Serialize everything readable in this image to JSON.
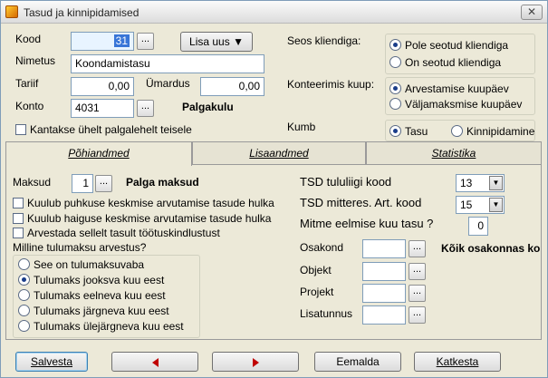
{
  "window": {
    "title": "Tasud ja kinnipidamised",
    "close_label": "✕"
  },
  "form": {
    "kood_label": "Kood",
    "kood_value": "31",
    "lisa_uus_label": "Lisa uus",
    "nimetus_label": "Nimetus",
    "nimetus_value": "Koondamistasu",
    "tariif_label": "Tariif",
    "tariif_value": "0,00",
    "umardus_label": "Ümardus",
    "umardus_value": "0,00",
    "konto_label": "Konto",
    "konto_value": "4031",
    "konto_name": "Palgakulu",
    "kantakse_label": "Kantakse ühelt palgalehelt teisele",
    "dots": "..."
  },
  "seos": {
    "label": "Seos kliendiga:",
    "options": [
      "Pole seotud kliendiga",
      "On seotud kliendiga"
    ],
    "selected": 0
  },
  "konteerimis": {
    "label": "Konteerimis kuup:",
    "options": [
      "Arvestamise kuupäev",
      "Väljamaksmise kuupäev"
    ],
    "selected": 0
  },
  "kumb": {
    "label": "Kumb",
    "options": [
      "Tasu",
      "Kinnipidamine"
    ],
    "selected": 0
  },
  "tabs": [
    "Põhiandmed",
    "Lisaandmed",
    "Statistika"
  ],
  "pohiandmed": {
    "maksud_label": "Maksud",
    "maksud_value": "1",
    "maksud_name": "Palga maksud",
    "checks": [
      "Kuulub puhkuse keskmise arvutamise tasude hulka",
      "Kuulub haiguse keskmise arvutamise tasude hulka",
      "Arvestada sellelt tasult töötuskindlustust"
    ],
    "tulumaks_label": "Milline tulumaksu arvestus?",
    "tulumaks_options": [
      "See on tulumaksuvaba",
      "Tulumaks jooksva kuu eest",
      "Tulumaks eelneva kuu eest",
      "Tulumaks järgneva kuu eest",
      "Tulumaks ülejärgneva kuu eest"
    ],
    "tulumaks_selected": 1,
    "tsd_tululiigi_label": "TSD tululiigi kood",
    "tsd_tululiigi_value": "13",
    "tsd_mitteres_label": "TSD mitteres. Art. kood",
    "tsd_mitteres_value": "15",
    "mitme_label": "Mitme eelmise kuu tasu ?",
    "mitme_value": "0",
    "osakond_label": "Osakond",
    "osakond_note": "Kõik osakonnas kol",
    "objekt_label": "Objekt",
    "projekt_label": "Projekt",
    "lisatunnus_label": "Lisatunnus"
  },
  "buttons": {
    "salvesta": "Salvesta",
    "eemalda": "Eemalda",
    "katkesta": "Katkesta"
  }
}
